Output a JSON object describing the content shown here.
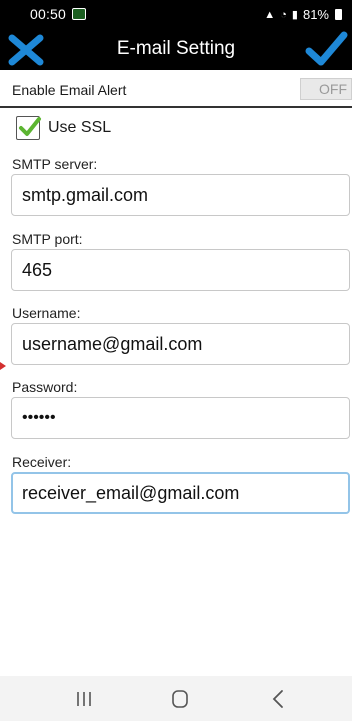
{
  "status_bar": {
    "time": "00:50",
    "battery": "81%",
    "icons": "signal-wifi-battery"
  },
  "header": {
    "title": "E-mail Setting",
    "close_icon": "close-x-icon",
    "confirm_icon": "checkmark-icon"
  },
  "alert": {
    "label": "Enable Email Alert",
    "toggle_text": "OFF"
  },
  "ssl": {
    "label": "Use SSL",
    "checked": true
  },
  "fields": {
    "smtp_server": {
      "label": "SMTP server:",
      "value": "smtp.gmail.com"
    },
    "smtp_port": {
      "label": "SMTP port:",
      "value": "465"
    },
    "username": {
      "label": "Username:",
      "value": "username@gmail.com"
    },
    "password": {
      "label": "Password:",
      "value": "••••••"
    },
    "receiver": {
      "label": "Receiver:",
      "value": "receiver_email@gmail.com"
    }
  },
  "colors": {
    "accent": "#1e88d7",
    "check_green": "#5cb531",
    "focus_border": "#93c4e8"
  }
}
